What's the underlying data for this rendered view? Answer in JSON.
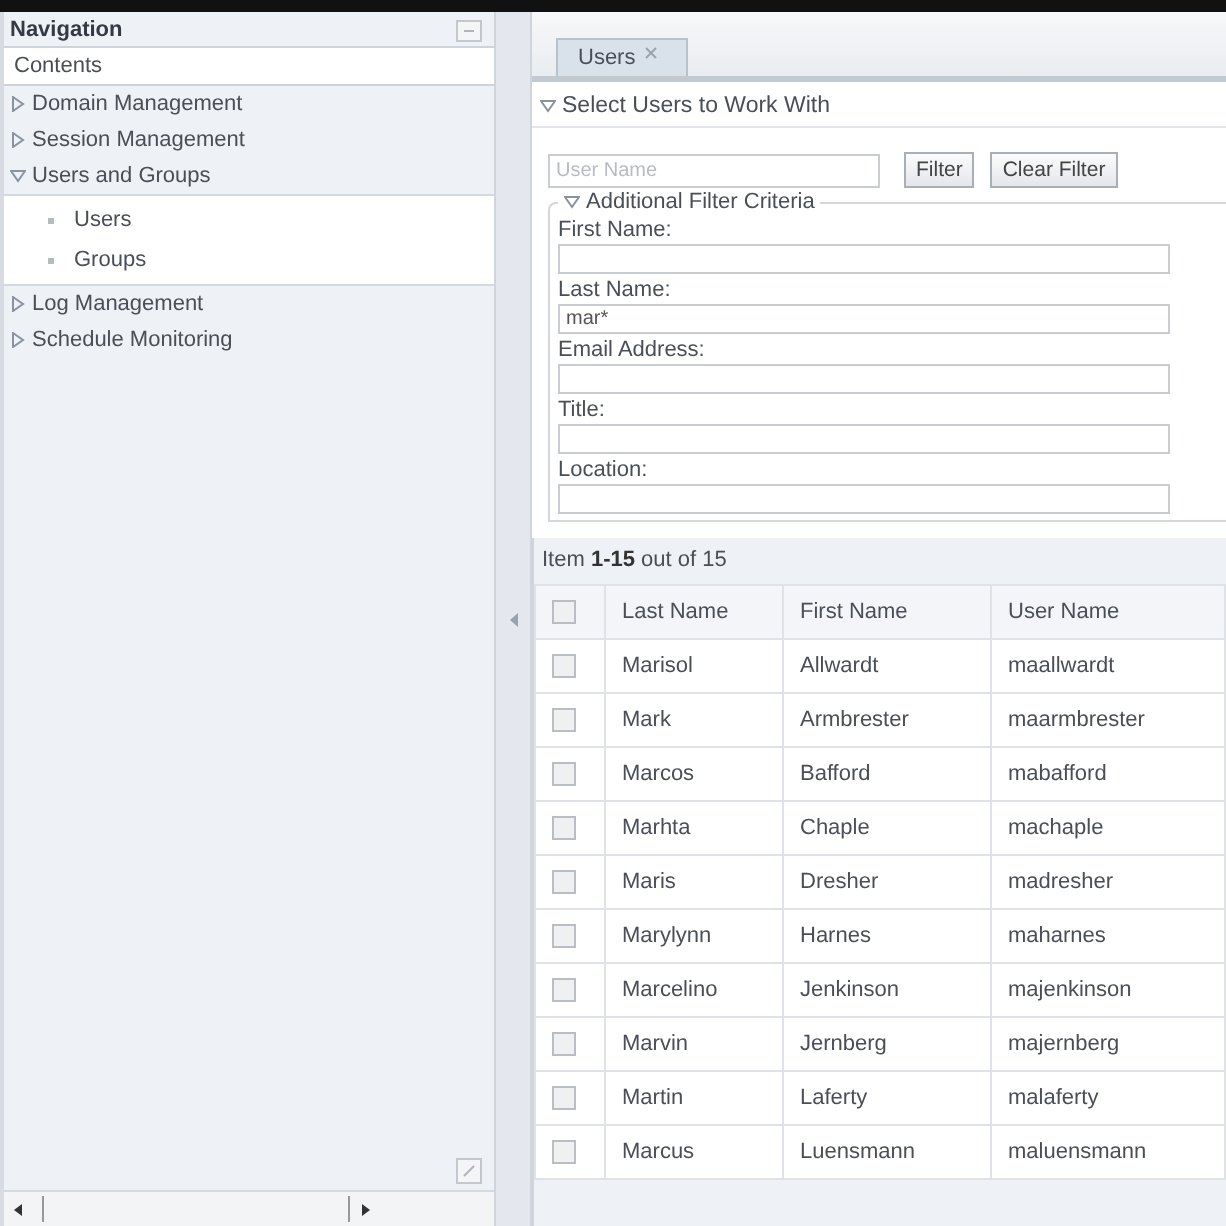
{
  "navigation": {
    "title": "Navigation",
    "contents_label": "Contents",
    "items": [
      {
        "label": "Domain Management",
        "expanded": false
      },
      {
        "label": "Session Management",
        "expanded": false
      },
      {
        "label": "Users and Groups",
        "expanded": true,
        "children": [
          {
            "label": "Users"
          },
          {
            "label": "Groups"
          }
        ]
      },
      {
        "label": "Log Management",
        "expanded": false
      },
      {
        "label": "Schedule Monitoring",
        "expanded": false
      }
    ]
  },
  "tabs": [
    {
      "label": "Users",
      "selected": true
    }
  ],
  "section": {
    "title": "Select Users to Work With",
    "expanded": true
  },
  "filter": {
    "placeholder": "User Name",
    "buttons": [
      "Filter",
      "Clear Filter"
    ]
  },
  "additional_criteria": {
    "title": "Additional Filter Criteria",
    "expanded": true,
    "fields": [
      {
        "label": "First Name:"
      },
      {
        "label": "Last Name:",
        "value": "mar*"
      },
      {
        "label": "Email Address:"
      },
      {
        "label": "Title:"
      },
      {
        "label": "Location:"
      }
    ]
  },
  "table": {
    "range_text": "Item **1-15** out of 15",
    "header_checked": false,
    "columns": [
      "Last Name",
      "First Name",
      "User Name"
    ],
    "rows": [
      {
        "checked": false,
        "cells": [
          "Marisol",
          "Allwardt",
          "maallwardt"
        ]
      },
      {
        "checked": false,
        "cells": [
          "Mark",
          "Armbrester",
          "maarmbrester"
        ]
      },
      {
        "checked": false,
        "cells": [
          "Marcos",
          "Bafford",
          "mabafford"
        ]
      },
      {
        "checked": false,
        "cells": [
          "Marhta",
          "Chaple",
          "machaple"
        ]
      },
      {
        "checked": false,
        "cells": [
          "Maris",
          "Dresher",
          "madresher"
        ]
      },
      {
        "checked": false,
        "cells": [
          "Marylynn",
          "Harnes",
          "maharnes"
        ]
      },
      {
        "checked": false,
        "cells": [
          "Marcelino",
          "Jenkinson",
          "majenkinson"
        ]
      },
      {
        "checked": false,
        "cells": [
          "Marvin",
          "Jernberg",
          "majernberg"
        ]
      },
      {
        "checked": false,
        "cells": [
          "Martin",
          "Laferty",
          "malaferty"
        ]
      },
      {
        "checked": false,
        "cells": [
          "Marcus",
          "Luensmann",
          "maluensmann"
        ]
      }
    ]
  }
}
